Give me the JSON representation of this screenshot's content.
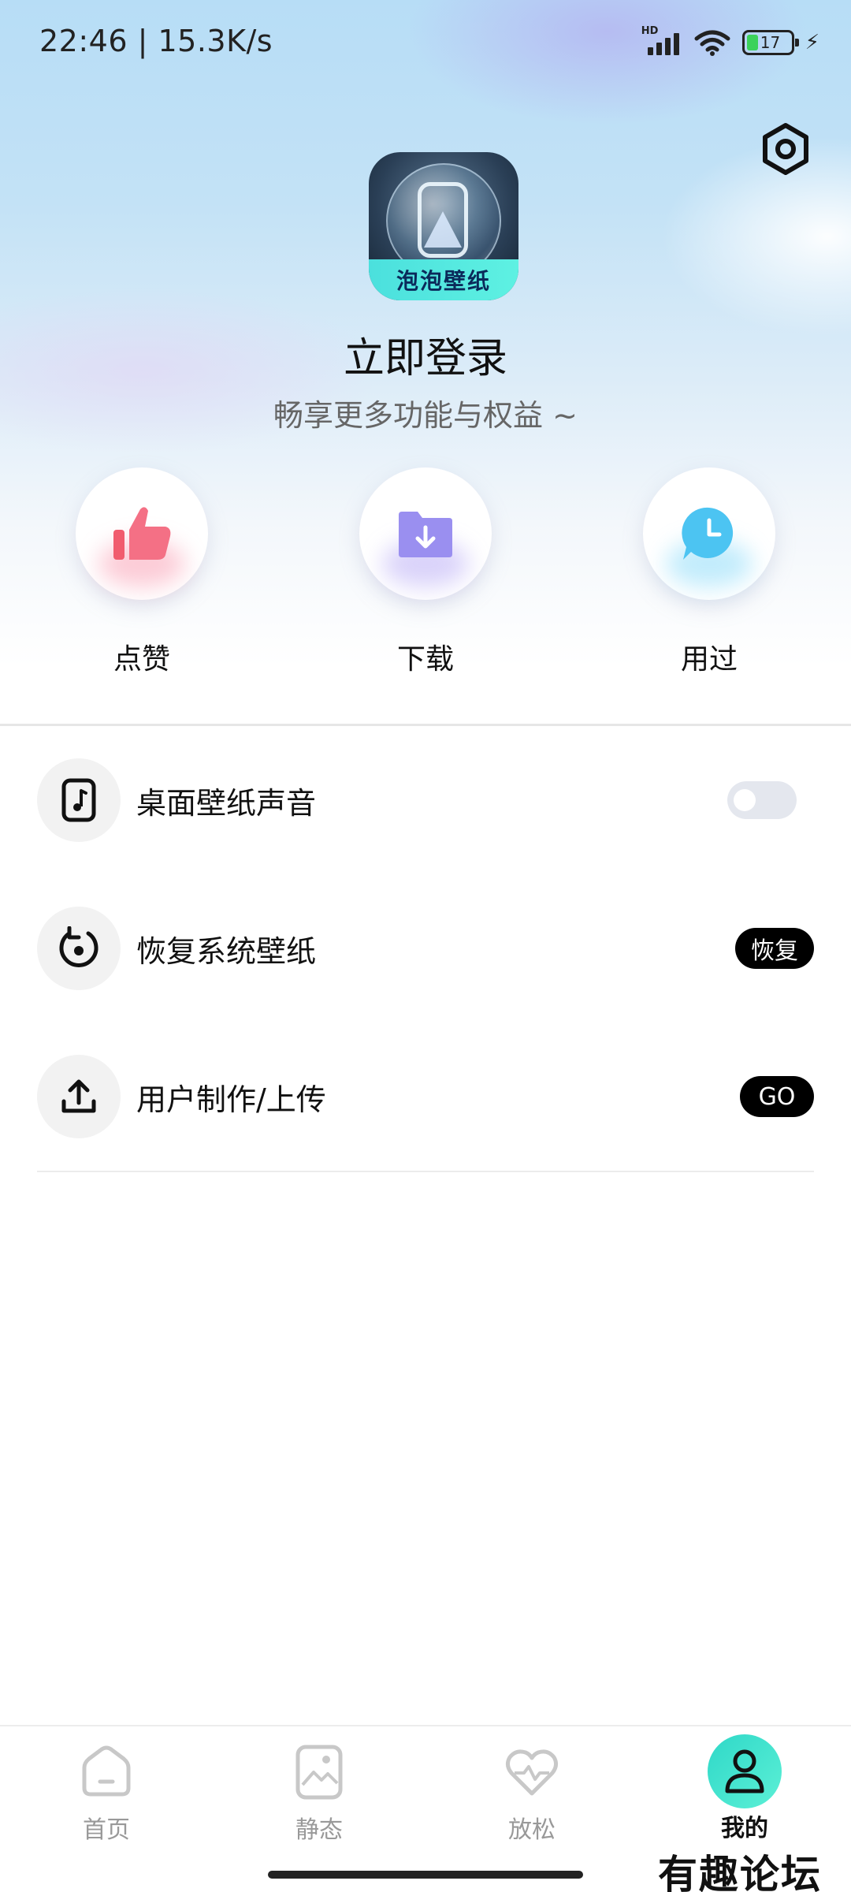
{
  "status_bar": {
    "time_speed": "22:46 | 15.3K/s",
    "network_badge": "HD",
    "battery_level": "17",
    "icons": [
      "signal-icon",
      "wifi-icon",
      "battery-icon",
      "charging-icon"
    ]
  },
  "header": {
    "settings_icon": "settings-icon",
    "app_logo_text": "泡泡壁纸",
    "login_title": "立即登录",
    "login_subtitle": "畅享更多功能与权益 ~"
  },
  "quick_actions": [
    {
      "label": "点赞",
      "icon": "thumbs-up-icon",
      "color": "#f15c6e"
    },
    {
      "label": "下载",
      "icon": "download-folder-icon",
      "color": "#8f84ea"
    },
    {
      "label": "用过",
      "icon": "clock-chat-icon",
      "color": "#4cc4f2"
    }
  ],
  "settings": [
    {
      "label": "桌面壁纸声音",
      "icon": "music-note-icon",
      "control": "toggle",
      "toggle_on": false
    },
    {
      "label": "恢复系统壁纸",
      "icon": "restore-icon",
      "control": "button",
      "button_label": "恢复"
    },
    {
      "label": "用户制作/上传",
      "icon": "upload-icon",
      "control": "button",
      "button_label": "GO"
    }
  ],
  "bottom_nav": {
    "tabs": [
      {
        "label": "首页",
        "icon": "home-icon",
        "active": false
      },
      {
        "label": "静态",
        "icon": "image-icon",
        "active": false
      },
      {
        "label": "放松",
        "icon": "heart-pulse-icon",
        "active": false
      },
      {
        "label": "我的",
        "icon": "profile-icon",
        "active": true
      }
    ],
    "active_color": "#3ee0cf"
  },
  "watermark": "有趣论坛"
}
